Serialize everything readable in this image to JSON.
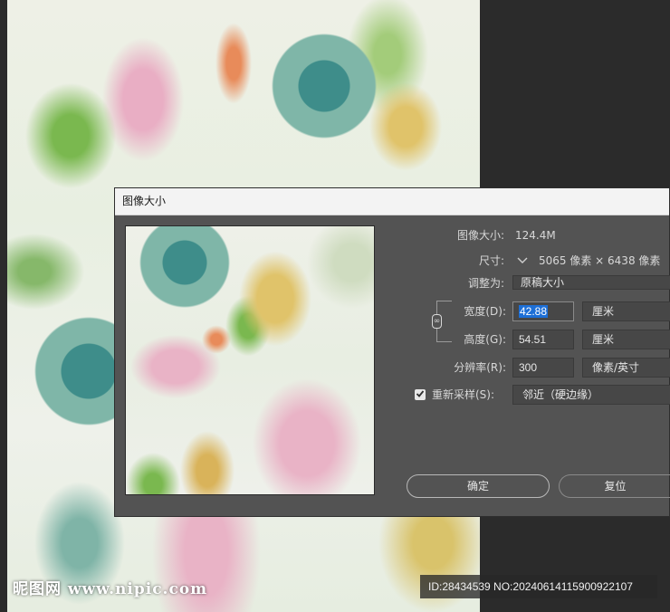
{
  "background_watermark": {
    "site_text": "昵图网 www.nipic.com",
    "id_text": "ID:28434539 NO:20240614115900922107"
  },
  "dialog": {
    "title": "图像大小",
    "image_size_label": "图像大小:",
    "image_size_value": "124.4M",
    "dimensions_label": "尺寸:",
    "dimensions_value": "5065 像素 × 6438 像素",
    "fit_to_label": "调整为:",
    "fit_to_value": "原稿大小",
    "width_label": "宽度(D):",
    "width_value": "42.88",
    "width_unit": "厘米",
    "height_label": "高度(G):",
    "height_value": "54.51",
    "height_unit": "厘米",
    "resolution_label": "分辨率(R):",
    "resolution_value": "300",
    "resolution_unit": "像素/英寸",
    "resample_label": "重新采样(S):",
    "resample_checked": true,
    "resample_value": "邻近（硬边缘）",
    "ok_button": "确定",
    "reset_button": "复位"
  },
  "icons": {
    "checkbox": "check-icon",
    "dimensions": "chevron-down-icon",
    "constrain": "link-chain-icon"
  },
  "colors": {
    "dialog_bg": "#535353",
    "field_bg": "#474747",
    "selection": "#1d6fd6",
    "titlebar": "#f3f3f3"
  }
}
